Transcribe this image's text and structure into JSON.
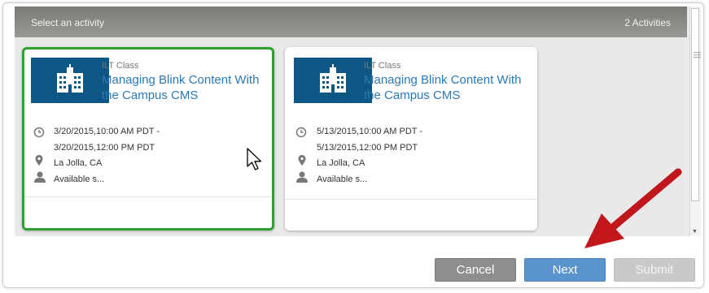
{
  "panel": {
    "title": "Select an activity",
    "count": "2 Activities"
  },
  "cards": [
    {
      "type": "ILT Class",
      "title": "Managing Blink Content With the Campus CMS",
      "date_start": "3/20/2015,10:00 AM PDT -",
      "date_end": "3/20/2015,12:00 PM PDT",
      "location": "La Jolla, CA",
      "availability": "Available s...",
      "selected": true
    },
    {
      "type": "ILT Class",
      "title": "Managing Blink Content With the Campus CMS",
      "date_start": "5/13/2015,10:00 AM PDT -",
      "date_end": "5/13/2015,12:00 PM PDT",
      "location": "La Jolla, CA",
      "availability": "Available s...",
      "selected": false
    }
  ],
  "buttons": {
    "cancel": "Cancel",
    "next": "Next",
    "submit": "Submit"
  },
  "colors": {
    "selected_border": "#2ea22e",
    "thumbnail_bg": "#0d5785",
    "title_link": "#2b79b6",
    "next_button": "#5b93cc",
    "annotation_arrow": "#c0161c"
  },
  "icons": {
    "thumbnail": "building-icon",
    "time": "clock-icon",
    "location": "map-pin-icon",
    "availability": "person-icon"
  }
}
